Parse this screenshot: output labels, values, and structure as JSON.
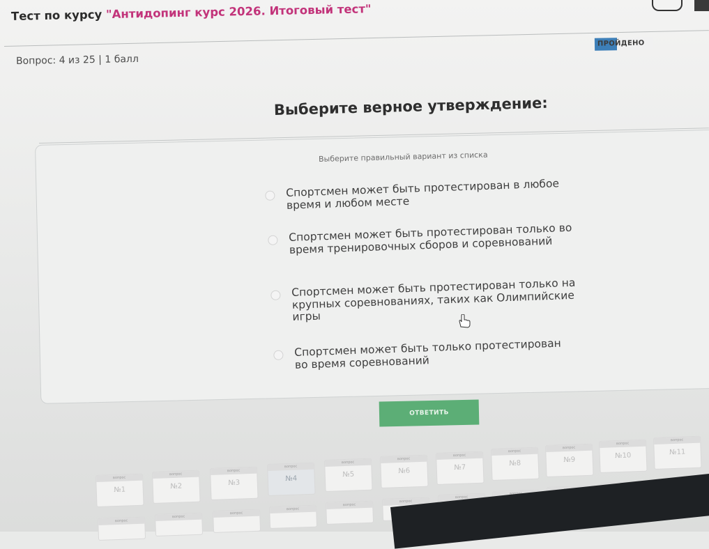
{
  "header": {
    "prefix": "Тест по курсу ",
    "course_name": "\"Антидопинг курс 2026. Итоговый тест\"",
    "status_badge": "ПРОЙДЕНО"
  },
  "progress": {
    "text": "Вопрос: 4 из 25 | 1 балл",
    "current": 4,
    "total": 25
  },
  "question": {
    "title": "Выберите верное утверждение:",
    "hint": "Выберите правильный вариант из списка",
    "options": [
      {
        "label": "Спортсмен может быть протестирован в любое время и любом месте",
        "selected": false
      },
      {
        "label": "Спортсмен может быть протестирован только во время тренировочных сборов и соревнований",
        "selected": false
      },
      {
        "label": "Спортсмен может быть протестирован только на крупных соревнованиях, таких как Олимпийские игры",
        "selected": false
      },
      {
        "label": "Спортсмен может быть только протестирован во время соревнований",
        "selected": false
      }
    ]
  },
  "answer_button": "ОТВЕТИТЬ",
  "nav": {
    "tile_caption": "вопрос",
    "tiles": [
      "№1",
      "№2",
      "№3",
      "№4",
      "№5",
      "№6",
      "№7",
      "№8",
      "№9",
      "№10",
      "№11"
    ],
    "current_index": 3
  },
  "colors": {
    "accent": "#c2337a",
    "answer_button": "#5cae76",
    "badge": "#3d7fb8"
  }
}
